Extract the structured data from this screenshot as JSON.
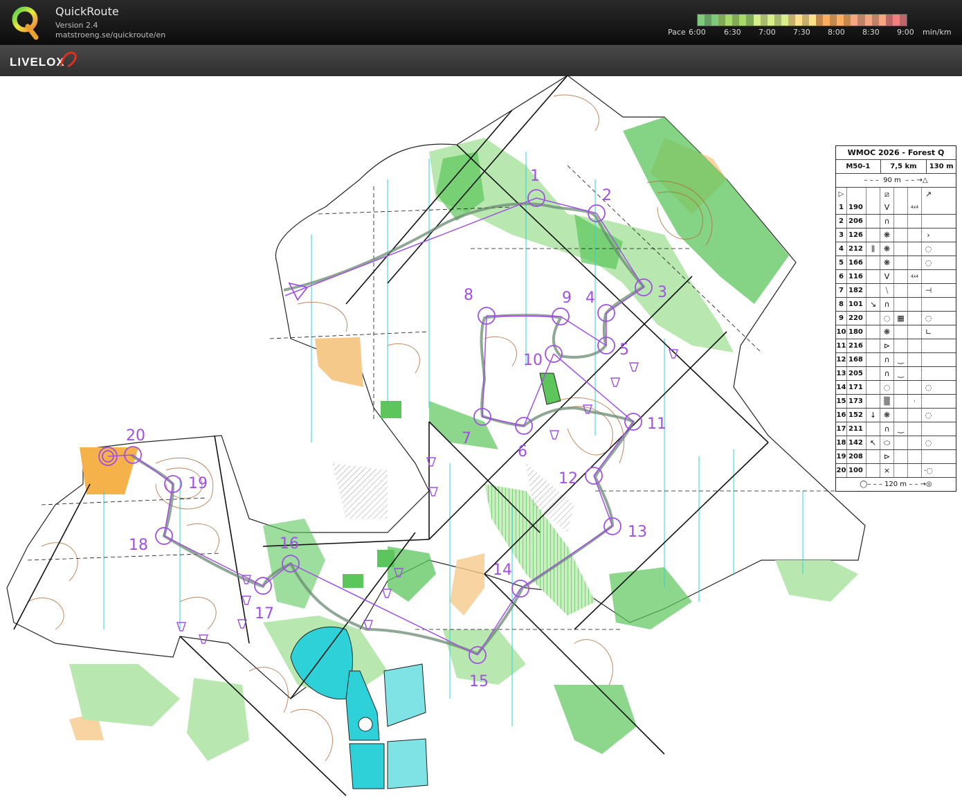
{
  "header": {
    "app_name": "QuickRoute",
    "version": "Version 2.4",
    "url": "matstroeng.se/quickroute/en",
    "pace_prefix": "Pace",
    "pace_labels": [
      "6:00",
      "6:30",
      "7:00",
      "7:30",
      "8:00",
      "8:30",
      "9:00"
    ],
    "pace_unit": "min/km",
    "pace_colors": [
      "#7fc97f",
      "#a6d96a",
      "#d9ef8b",
      "#fee08b",
      "#fdae61",
      "#f4a582",
      "#f08080"
    ]
  },
  "brand": {
    "name": "LIVELOX",
    "swoosh_color": "#e03020"
  },
  "map": {
    "colors": {
      "forest_green": "#5cc65c",
      "light_green": "#b8e8b0",
      "open_yellow": "#f5c98a",
      "water": "#2ed1d8",
      "course": "#a050e0",
      "route": "#6a8a72",
      "contour": "#b06a3a"
    },
    "control_labels": [
      "1",
      "2",
      "3",
      "4",
      "5",
      "6",
      "7",
      "8",
      "9",
      "10",
      "11",
      "12",
      "13",
      "14",
      "15",
      "16",
      "17",
      "18",
      "19",
      "20"
    ]
  },
  "description_sheet": {
    "title": "WMOC 2026 - Forest Q",
    "class": "M50-1",
    "length": "7,5 km",
    "climb": "130 m",
    "start_marking": "90 m",
    "finish_marking": "120 m",
    "controls": [
      {
        "n": "1",
        "code": "190",
        "c3": "",
        "c4": "V",
        "c5": "",
        "c6": "4x4",
        "c7": ""
      },
      {
        "n": "2",
        "code": "206",
        "c3": "",
        "c4": "∩",
        "c5": "",
        "c6": "",
        "c7": ""
      },
      {
        "n": "3",
        "code": "126",
        "c3": "",
        "c4": "❋",
        "c5": "",
        "c6": "",
        "c7": "›"
      },
      {
        "n": "4",
        "code": "212",
        "c3": "⫼",
        "c4": "❋",
        "c5": "",
        "c6": "",
        "c7": "◌"
      },
      {
        "n": "5",
        "code": "166",
        "c3": "",
        "c4": "❋",
        "c5": "",
        "c6": "",
        "c7": "◌"
      },
      {
        "n": "6",
        "code": "116",
        "c3": "",
        "c4": "V",
        "c5": "",
        "c6": "4x4",
        "c7": ""
      },
      {
        "n": "7",
        "code": "182",
        "c3": "",
        "c4": "⧹",
        "c5": "",
        "c6": "",
        "c7": "⊣"
      },
      {
        "n": "8",
        "code": "101",
        "c3": "↘",
        "c4": "∩",
        "c5": "",
        "c6": "",
        "c7": ""
      },
      {
        "n": "9",
        "code": "220",
        "c3": "",
        "c4": "◌",
        "c5": "▦",
        "c6": "",
        "c7": "◌"
      },
      {
        "n": "10",
        "code": "180",
        "c3": "",
        "c4": "❋",
        "c5": "",
        "c6": "",
        "c7": "∟"
      },
      {
        "n": "11",
        "code": "216",
        "c3": "",
        "c4": "⊳",
        "c5": "",
        "c6": "",
        "c7": ""
      },
      {
        "n": "12",
        "code": "168",
        "c3": "",
        "c4": "∩",
        "c5": "‿",
        "c6": "",
        "c7": ""
      },
      {
        "n": "13",
        "code": "205",
        "c3": "",
        "c4": "∩",
        "c5": "‿",
        "c6": "",
        "c7": ""
      },
      {
        "n": "14",
        "code": "171",
        "c3": "",
        "c4": "◌",
        "c5": "",
        "c6": "",
        "c7": "◌"
      },
      {
        "n": "15",
        "code": "173",
        "c3": "",
        "c4": "▒",
        "c5": "",
        "c6": "‹",
        "c7": ""
      },
      {
        "n": "16",
        "code": "152",
        "c3": "↓",
        "c4": "❋",
        "c5": "",
        "c6": "",
        "c7": "◌"
      },
      {
        "n": "17",
        "code": "211",
        "c3": "",
        "c4": "∩",
        "c5": "‿",
        "c6": "",
        "c7": ""
      },
      {
        "n": "18",
        "code": "142",
        "c3": "↖",
        "c4": "⬭",
        "c5": "",
        "c6": "",
        "c7": "◌"
      },
      {
        "n": "19",
        "code": "208",
        "c3": "",
        "c4": "⊳",
        "c5": "",
        "c6": "",
        "c7": ""
      },
      {
        "n": "20",
        "code": "100",
        "c3": "",
        "c4": "×",
        "c5": "",
        "c6": "",
        "c7": "·◌"
      }
    ]
  }
}
